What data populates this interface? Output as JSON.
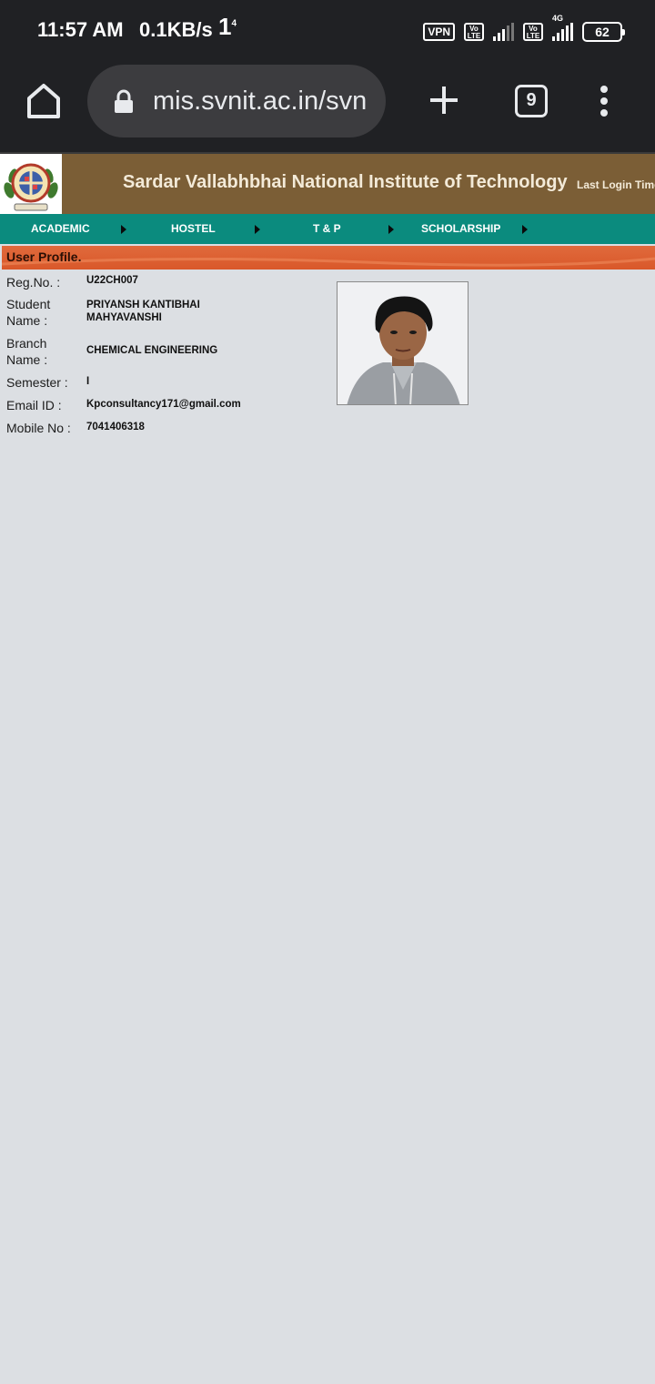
{
  "status_bar": {
    "time": "11:57 AM",
    "speed": "0.1KB/s",
    "extra": "1",
    "extra_sup": "4",
    "vpn": "VPN",
    "volte1": "Vo LTE",
    "volte2": "Vo LTE",
    "network": "4G",
    "battery": "62"
  },
  "browser": {
    "url": "mis.svnit.ac.in/svn",
    "tab_count": "9"
  },
  "site": {
    "title": "Sardar Vallabhbhai National Institute of Technology",
    "last_login": "Last Login Time"
  },
  "nav": {
    "items": [
      {
        "label": "ACADEMIC"
      },
      {
        "label": "HOSTEL"
      },
      {
        "label": "T & P"
      },
      {
        "label": "SCHOLARSHIP"
      }
    ]
  },
  "section": {
    "title": "User Profile."
  },
  "profile": {
    "reg_label": "Reg.No. :",
    "reg_value": "U22CH007",
    "name_label_1": "Student",
    "name_label_2": "Name :",
    "name_value_1": "PRIYANSH KANTIBHAI",
    "name_value_2": "MAHYAVANSHI",
    "branch_label_1": "Branch",
    "branch_label_2": "Name :",
    "branch_value": "CHEMICAL ENGINEERING",
    "semester_label": "Semester :",
    "semester_value": "I",
    "email_label": "Email ID :",
    "email_value": "Kpconsultancy171@gmail.com",
    "mobile_label": "Mobile No :",
    "mobile_value": "7041406318"
  },
  "colors": {
    "header_brown": "#7b5e36",
    "nav_teal": "#0b8b7e",
    "banner_orange": "#d9582a",
    "page_bg": "#dcdfe3"
  }
}
